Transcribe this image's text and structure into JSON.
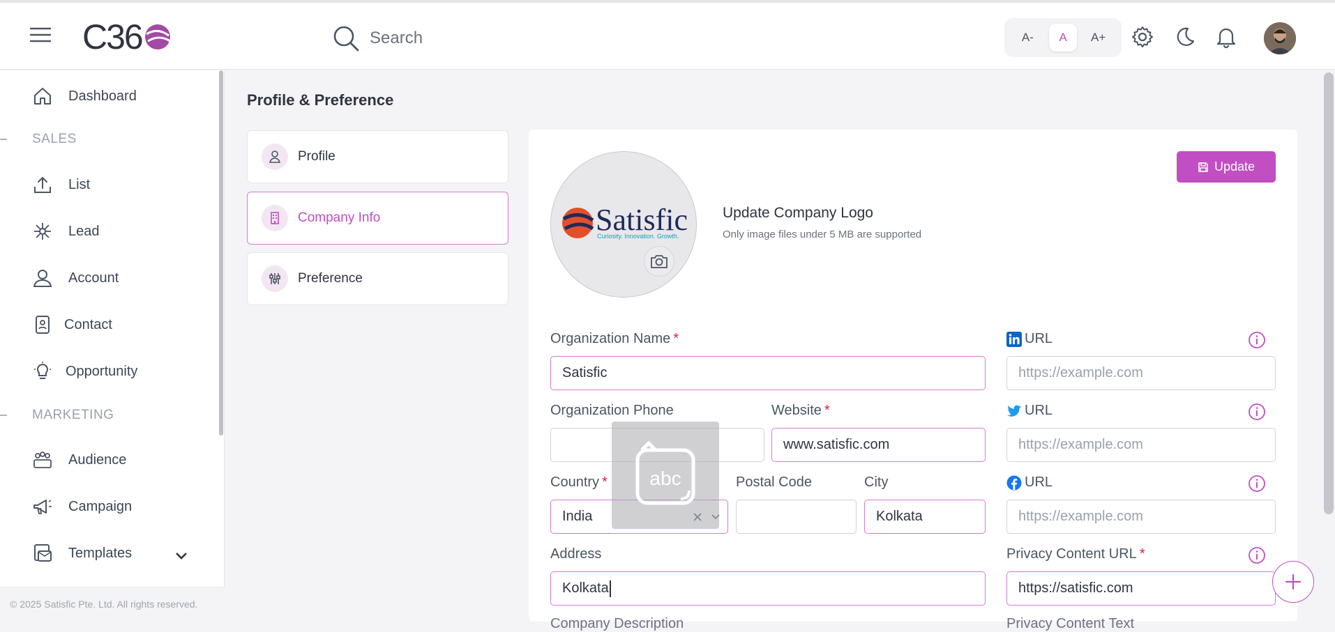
{
  "header": {
    "logo_text": "C36",
    "search_placeholder": "Search",
    "font_small": "A-",
    "font_normal": "A",
    "font_large": "A+"
  },
  "sidebar": {
    "items": [
      {
        "label": "Dashboard",
        "icon": "home-icon"
      },
      {
        "label": "List",
        "icon": "upload-icon"
      },
      {
        "label": "Lead",
        "icon": "network-icon"
      },
      {
        "label": "Account",
        "icon": "user-icon"
      },
      {
        "label": "Contact",
        "icon": "contact-icon"
      },
      {
        "label": "Opportunity",
        "icon": "lightbulb-icon"
      },
      {
        "label": "Audience",
        "icon": "group-icon"
      },
      {
        "label": "Campaign",
        "icon": "megaphone-icon"
      },
      {
        "label": "Templates",
        "icon": "template-icon"
      }
    ],
    "sections": {
      "sales": "SALES",
      "marketing": "MARKETING"
    },
    "footer": "© 2025 Satisfic Pte. Ltd. All rights reserved."
  },
  "page": {
    "title": "Profile & Preference",
    "tabs": [
      {
        "label": "Profile"
      },
      {
        "label": "Company Info"
      },
      {
        "label": "Preference"
      }
    ]
  },
  "company": {
    "logo_brand": "Satisfic",
    "logo_tagline": "Curiosity. Innovation. Growth.",
    "update_logo_title": "Update Company Logo",
    "update_logo_sub": "Only image files under 5 MB are supported",
    "update_button": "Update",
    "org_name_label": "Organization Name",
    "org_name_value": "Satisfic",
    "org_phone_label": "Organization Phone",
    "org_phone_value": "",
    "website_label": "Website",
    "website_value": "www.satisfic.com",
    "country_label": "Country",
    "country_value": "India",
    "postal_label": "Postal Code",
    "postal_value": "",
    "city_label": "City",
    "city_value": "Kolkata",
    "address_label": "Address",
    "address_value": "Kolkata",
    "linkedin_label": "URL",
    "twitter_label": "URL",
    "facebook_label": "URL",
    "url_placeholder": "https://example.com",
    "privacy_label": "Privacy Content URL",
    "privacy_value": "https://satisfic.com",
    "cut_left": "Company Description",
    "cut_right": "Privacy Content Text",
    "keyboard_text": "abc"
  },
  "colors": {
    "accent": "#c14ec2",
    "required": "#e11d48"
  }
}
